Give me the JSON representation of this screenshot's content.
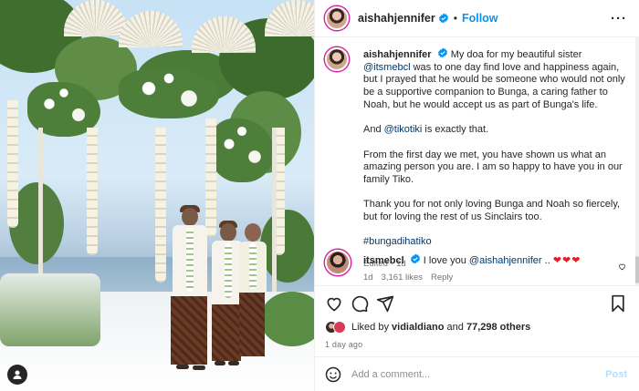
{
  "post": {
    "author": "aishahjennifer",
    "verified": true,
    "separator": "•",
    "follow_label": "Follow",
    "more_label": "···"
  },
  "caption": {
    "author": "aishahjennifer",
    "p1_a": "My doa for my beautiful sister ",
    "p1_mention": "@itsmebcl",
    "p1_b": " was to one day find love and happiness again, but I prayed that he would be someone who would not only be a supportive companion to Bunga, a caring father to Noah, but he would accept us as part of Bunga's life.",
    "p2_a": "And ",
    "p2_mention": "@tikotiki",
    "p2_b": " is exactly that.",
    "p3": "From the first day we met, you have shown us what an amazing person you are. I am so happy to have you in our family Tiko.",
    "p4": "Thank you for not only loving Bunga and Noah so fiercely, but for loving the rest of us Sinclairs too.",
    "hashtag": "#bungadihatiko",
    "edited": "Edited",
    "meta_sep": "·",
    "age": "1d"
  },
  "comment": {
    "author": "itsmebcl",
    "text_a": "I love you ",
    "mention": "@aishahjennifer",
    "text_b": " .. ",
    "hearts": "❤❤❤",
    "age": "1d",
    "likes": "3,161 likes",
    "reply": "Reply"
  },
  "likes": {
    "prefix": "Liked by ",
    "user": "vidialdiano",
    "mid": " and ",
    "count": "77,298 others"
  },
  "time": "1 day ago",
  "add_comment": {
    "placeholder": "Add a comment...",
    "post_label": "Post"
  },
  "colors": {
    "link_blue": "#0095f6",
    "mention": "#00376b",
    "heart": "#ed1c24",
    "muted": "#737373"
  },
  "icons": [
    "verified-icon",
    "more-icon",
    "heart-icon",
    "comment-icon",
    "share-icon",
    "save-icon",
    "emoji-icon",
    "user-tag-icon"
  ]
}
